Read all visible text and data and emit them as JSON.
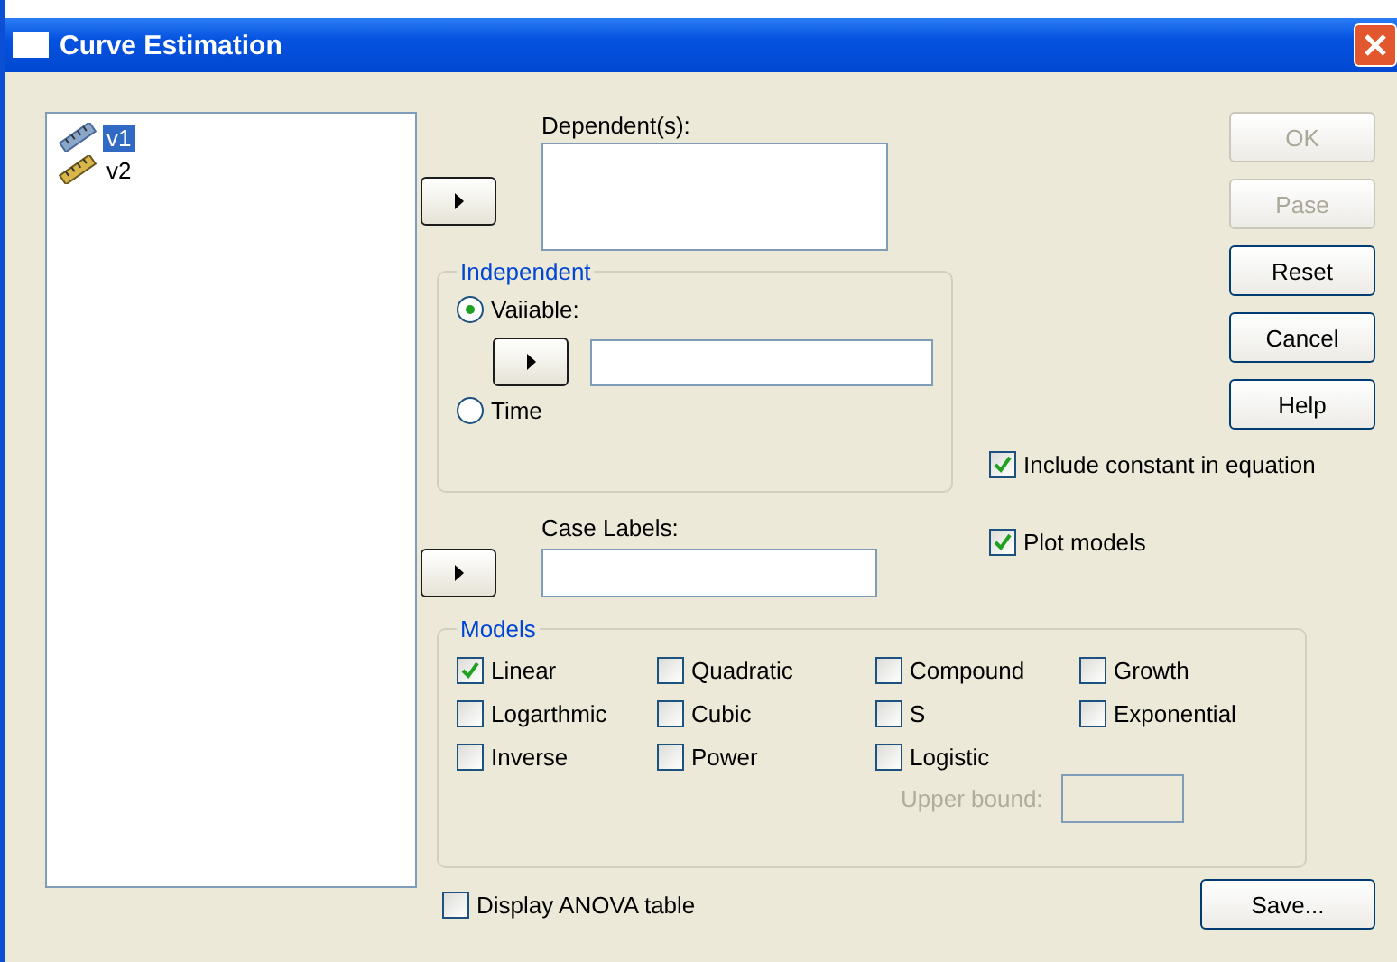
{
  "window": {
    "title": "Curve Estimation"
  },
  "variables": [
    {
      "name": "v1",
      "selected": true
    },
    {
      "name": "v2",
      "selected": false
    }
  ],
  "dependent": {
    "label": "Dependent(s):"
  },
  "independent": {
    "title": "Independent",
    "options": [
      {
        "label": "Vaiiable:",
        "selected": true
      },
      {
        "label": "Time",
        "selected": false
      }
    ]
  },
  "case_labels": {
    "label": "Case Labels:"
  },
  "buttons": [
    {
      "label": "OK",
      "disabled": true
    },
    {
      "label": "Pase",
      "disabled": true
    },
    {
      "label": "Reset",
      "disabled": false
    },
    {
      "label": "Cancel",
      "disabled": false
    },
    {
      "label": "Help",
      "disabled": false
    }
  ],
  "options": [
    {
      "label": "Include constant in equation",
      "checked": true
    },
    {
      "label": "Plot models",
      "checked": true
    }
  ],
  "models": {
    "title": "Models",
    "items": [
      {
        "label": "Linear",
        "checked": true
      },
      {
        "label": "Quadratic",
        "checked": false
      },
      {
        "label": "Compound",
        "checked": false
      },
      {
        "label": "Growth",
        "checked": false
      },
      {
        "label": "Logarthmic",
        "checked": false
      },
      {
        "label": "Cubic",
        "checked": false
      },
      {
        "label": "S",
        "checked": false
      },
      {
        "label": "Exponential",
        "checked": false
      },
      {
        "label": "Inverse",
        "checked": false
      },
      {
        "label": "Power",
        "checked": false
      },
      {
        "label": "Logistic",
        "checked": false
      }
    ],
    "upper_bound": {
      "label": "Upper bound:",
      "disabled": true
    }
  },
  "anova": {
    "label": "Display ANOVA table",
    "checked": false
  },
  "save_button": {
    "label": "Save..."
  }
}
